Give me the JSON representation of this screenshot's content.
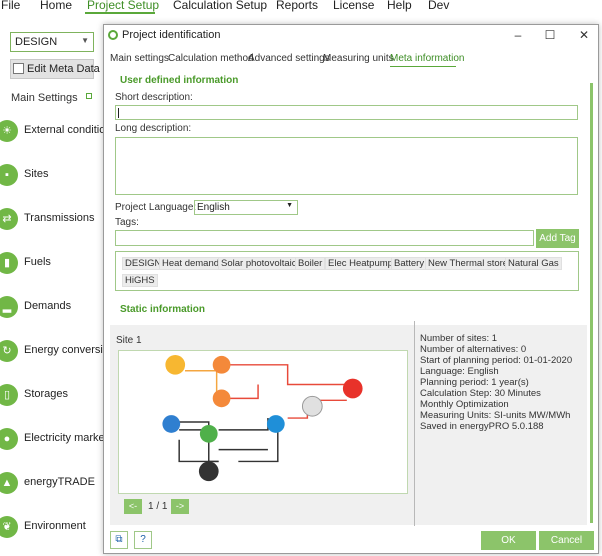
{
  "menubar": {
    "items": [
      "File",
      "Home",
      "Project Setup",
      "Calculation Setup",
      "Reports",
      "License",
      "Help",
      "Dev"
    ],
    "active_index": 2
  },
  "sidebar": {
    "design_select": "DESIGN",
    "edit_meta_label": "Edit Meta Data",
    "main_settings_label": "Main Settings",
    "items": [
      {
        "label": "External conditions",
        "icon": "sun-icon"
      },
      {
        "label": "Sites",
        "icon": "sites-icon"
      },
      {
        "label": "Transmissions",
        "icon": "transmission-icon"
      },
      {
        "label": "Fuels",
        "icon": "fuel-icon"
      },
      {
        "label": "Demands",
        "icon": "demand-icon"
      },
      {
        "label": "Energy conversion",
        "icon": "conversion-icon"
      },
      {
        "label": "Storages",
        "icon": "storage-icon"
      },
      {
        "label": "Electricity markets",
        "icon": "bulb-icon"
      },
      {
        "label": "energyTRADE",
        "icon": "trade-icon"
      },
      {
        "label": "Environment",
        "icon": "leaf-icon"
      }
    ]
  },
  "dialog": {
    "title": "Project identification",
    "tabs": [
      "Main settings",
      "Calculation method",
      "Advanced settings",
      "Measuring units",
      "Meta information"
    ],
    "active_tab": 4,
    "user_section_title": "User defined information",
    "short_desc_label": "Short description:",
    "short_desc_value": "",
    "long_desc_label": "Long description:",
    "long_desc_value": "",
    "language_label": "Project Language:",
    "language_value": "English",
    "tags_label": "Tags:",
    "add_tag_label": "Add Tag",
    "tags": [
      "DESIGN",
      "Heat demand",
      "Solar photovoltaic",
      "Boiler",
      "Elec Heatpump",
      "Battery",
      "New Thermal store",
      "Natural Gas",
      "HiGHS"
    ],
    "static_section_title": "Static information",
    "site_label": "Site 1",
    "pager": {
      "prev": "<-",
      "next": "->",
      "text": "1 / 1"
    },
    "info_lines": [
      "Number of sites: 1",
      "Number of alternatives: 0",
      "Start of planning period: 01-01-2020",
      "Language: English",
      "Planning period: 1 year(s)",
      "Calculation Step: 30 Minutes",
      "Monthly Optimization",
      "Measuring Units: SI-units MW/MWh",
      "Saved in energyPRO 5.0.188"
    ],
    "ok_label": "OK",
    "cancel_label": "Cancel"
  },
  "colors": {
    "accent": "#5aa83a",
    "button": "#8cc46a",
    "sidebar_icon": "#71b746"
  }
}
